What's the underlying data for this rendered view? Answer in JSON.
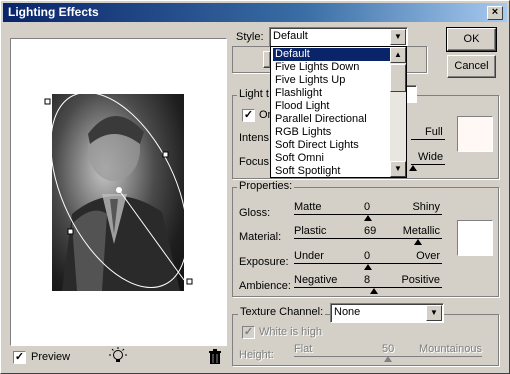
{
  "window": {
    "title": "Lighting Effects",
    "close_glyph": "×"
  },
  "preview": {
    "checkbox_checked": true,
    "preview_label": "Preview",
    "light_bulb_icon": "light-bulb-icon",
    "trash_icon": "trash-icon"
  },
  "style": {
    "label": "Style:",
    "selected": "Default",
    "options": [
      "Default",
      "Five Lights Down",
      "Five Lights Up",
      "Flashlight",
      "Flood Light",
      "Parallel Directional",
      "RGB Lights",
      "Soft Direct Lights",
      "Soft Omni",
      "Soft Spotlight"
    ]
  },
  "buttons": {
    "ok": "OK",
    "cancel": "Cancel"
  },
  "light_type": {
    "group_label": "Light t",
    "on_label": "On",
    "intensity_label": "Intens",
    "intensity_right": "Full",
    "focus_label": "Focus",
    "focus_right": "Wide",
    "color": "#fff8f5"
  },
  "properties": {
    "group_label": "Properties:",
    "rows": [
      {
        "label": "Gloss:",
        "left": "Matte",
        "value": "0",
        "right": "Shiny",
        "pos": 0.5
      },
      {
        "label": "Material:",
        "left": "Plastic",
        "value": "69",
        "right": "Metallic",
        "pos": 0.84
      },
      {
        "label": "Exposure:",
        "left": "Under",
        "value": "0",
        "right": "Over",
        "pos": 0.5
      },
      {
        "label": "Ambience:",
        "left": "Negative",
        "value": "8",
        "right": "Positive",
        "pos": 0.54
      }
    ],
    "color": "#ffffff"
  },
  "texture": {
    "label": "Texture Channel:",
    "selected": "None",
    "white_is_high": "White is high",
    "height_label": "Height:",
    "height_left": "Flat",
    "height_value": "50",
    "height_right": "Mountainous",
    "height_pos": 0.5
  }
}
